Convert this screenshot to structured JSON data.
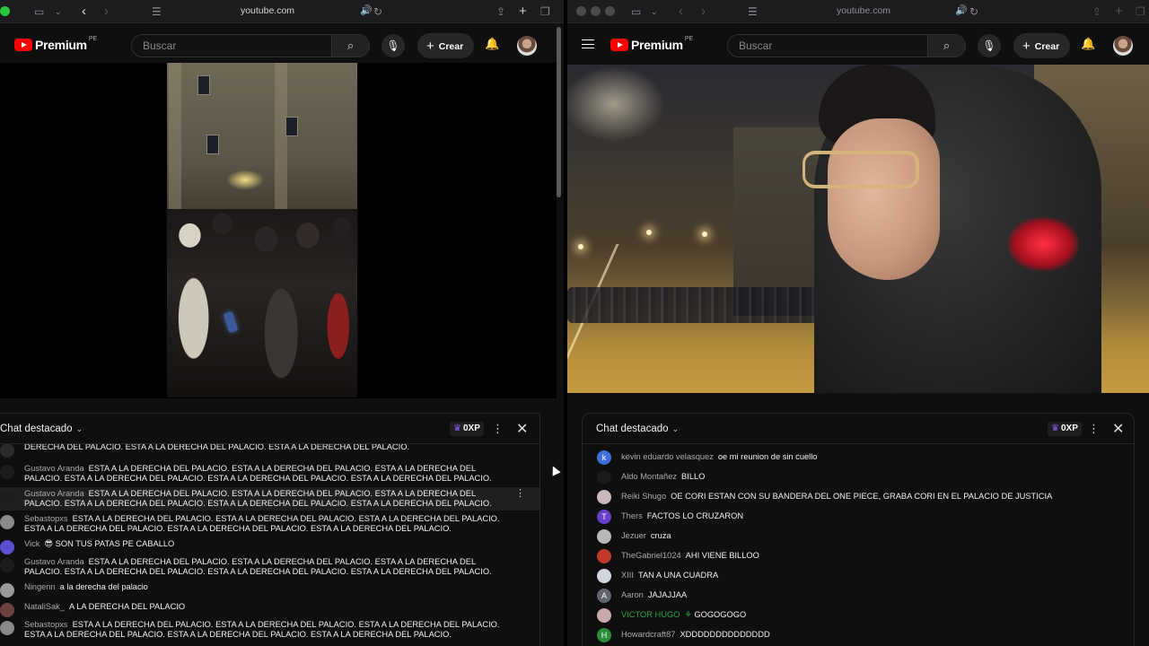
{
  "left": {
    "url": "youtube.com",
    "logo": "Premium",
    "logo_sup": "PE",
    "search_placeholder": "Buscar",
    "create_label": "Crear",
    "chat_title": "Chat destacado",
    "xp": "0XP",
    "messages": [
      {
        "author": "",
        "text": "DERECHA DEL PALACIO. ESTA A LA DERECHA DEL PALACIO. ESTA A LA DERECHA DEL PALACIO.",
        "avatar": "#2a2a2a"
      },
      {
        "author": "Gustavo Aranda",
        "text": "ESTA A LA DERECHA DEL PALACIO. ESTA A LA DERECHA DEL PALACIO. ESTA A LA DERECHA DEL PALACIO. ESTA A LA DERECHA DEL PALACIO. ESTA A LA DERECHA DEL PALACIO. ESTA A LA DERECHA DEL PALACIO.",
        "avatar": "#1c1c1c"
      },
      {
        "author": "Gustavo Aranda",
        "text": "ESTA A LA DERECHA DEL PALACIO. ESTA A LA DERECHA DEL PALACIO. ESTA A LA DERECHA DEL PALACIO. ESTA A LA DERECHA DEL PALACIO. ESTA A LA DERECHA DEL PALACIO. ESTA A LA DERECHA DEL PALACIO.",
        "avatar": "#1c1c1c"
      },
      {
        "author": "Sebastopxs",
        "text": "ESTA A LA DERECHA DEL PALACIO. ESTA A LA DERECHA DEL PALACIO. ESTA A LA DERECHA DEL PALACIO. ESTA A LA DERECHA DEL PALACIO. ESTA A LA DERECHA DEL PALACIO. ESTA A LA DERECHA DEL PALACIO.",
        "avatar": "#8a8a8a"
      },
      {
        "author": "Vick",
        "text": "😎  SON TUS PATAS PE CABALLO",
        "avatar": "#5b4fd1"
      },
      {
        "author": "Gustavo Aranda",
        "text": "ESTA A LA DERECHA DEL PALACIO. ESTA A LA DERECHA DEL PALACIO. ESTA A LA DERECHA DEL PALACIO. ESTA A LA DERECHA DEL PALACIO. ESTA A LA DERECHA DEL PALACIO. ESTA A LA DERECHA DEL PALACIO.",
        "avatar": "#1c1c1c"
      },
      {
        "author": "Ningenn",
        "text": "a la derecha del palacio",
        "avatar": "#9a9a9a"
      },
      {
        "author": "NataliSak_",
        "text": "A LA DERECHA DEL PALACIO",
        "avatar": "#6a4040"
      },
      {
        "author": "Sebastopxs",
        "text": "ESTA A LA DERECHA DEL PALACIO. ESTA A LA DERECHA DEL PALACIO. ESTA A LA DERECHA DEL PALACIO. ESTA A LA DERECHA DEL PALACIO. ESTA A LA DERECHA DEL PALACIO. ESTA A LA DERECHA DEL PALACIO.",
        "avatar": "#8a8a8a"
      }
    ]
  },
  "right": {
    "url": "youtube.com",
    "logo": "Premium",
    "logo_sup": "PE",
    "search_placeholder": "Buscar",
    "create_label": "Crear",
    "chat_title": "Chat destacado",
    "xp": "0XP",
    "messages": [
      {
        "author": "kevin eduardo velasquez",
        "text": "oe mi reunion de sin cuello",
        "avatar": "#3e6fd8",
        "initial": "k"
      },
      {
        "author": "Aldo Montañez",
        "text": "BILLO",
        "avatar": "#1a1a1a",
        "initial": ""
      },
      {
        "author": "Reiki Shugo",
        "text": "OE CORI ESTAN CON SU BANDERA DEL ONE PIECE, GRABA CORI EN EL PALACIO DE JUSTICIA",
        "avatar": "#c9b9b9",
        "initial": ""
      },
      {
        "author": "Thers",
        "text": "FACTOS LO CRUZARON",
        "avatar": "#6a3fc8",
        "initial": "T"
      },
      {
        "author": "Jezuer",
        "text": "cruza",
        "avatar": "#b8b8b8",
        "initial": ""
      },
      {
        "author": "TheGabriel1024",
        "text": "AHI VIENE BILLOO",
        "avatar": "#c0392b",
        "initial": ""
      },
      {
        "author": "XIII",
        "text": "TAN A UNA CUADRA",
        "avatar": "#d0d6e0",
        "initial": ""
      },
      {
        "author": "Aaron",
        "text": "JAJAJJAA",
        "avatar": "#5f6670",
        "initial": "A"
      },
      {
        "author": "VICTOR HUGO",
        "text": "GOGOGOGO",
        "avatar": "#c8a8a8",
        "initial": "",
        "member": true
      },
      {
        "author": "Howardcraft87",
        "text": "XDDDDDDDDDDDDDD",
        "avatar": "#2e8b3e",
        "initial": "H"
      }
    ]
  },
  "colors": {
    "accent_red": "#ff0000",
    "member_green": "#2ba640",
    "xp_crown": "#8b5cf6"
  }
}
